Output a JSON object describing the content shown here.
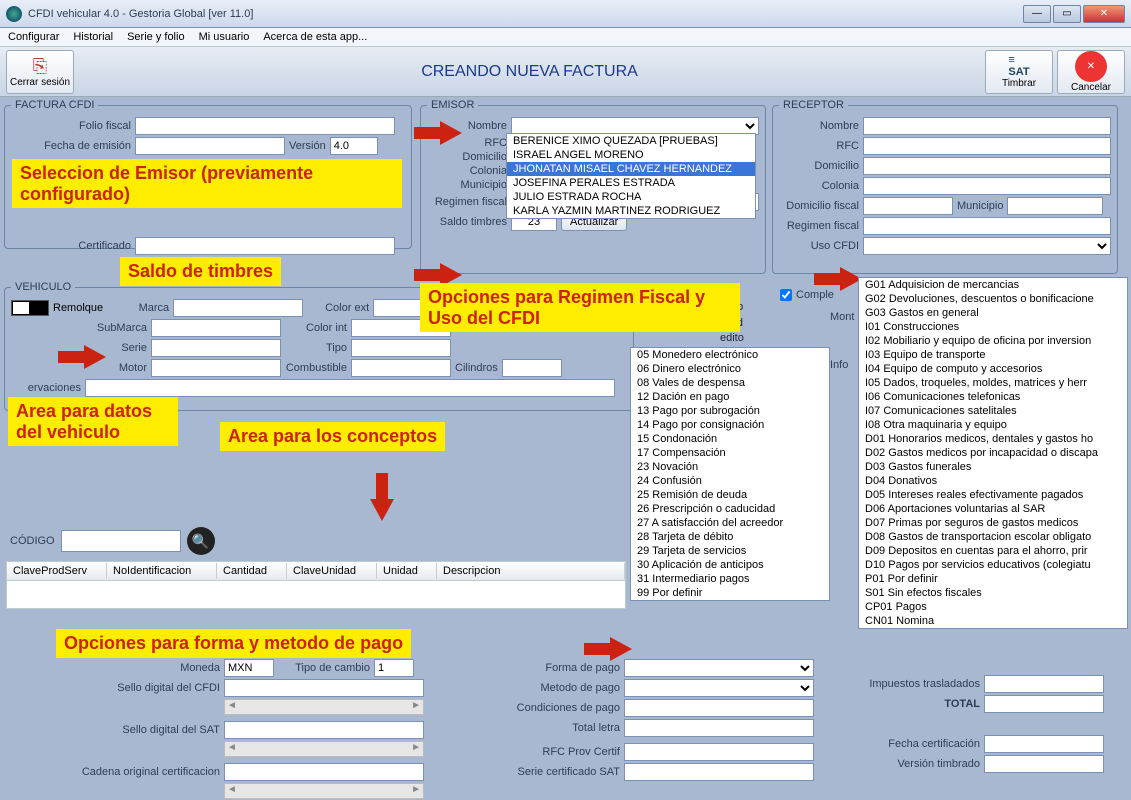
{
  "window": {
    "title": "CFDI vehicular 4.0 - Gestoria Global [ver 11.0]"
  },
  "menu": {
    "items": [
      "Configurar",
      "Historial",
      "Serie y folio",
      "Mi usuario",
      "Acerca de esta app..."
    ]
  },
  "toolbar": {
    "logout": "Cerrar sesión",
    "title": "CREANDO NUEVA FACTURA",
    "timbrar": "Timbrar",
    "cancelar": "Cancelar"
  },
  "factura": {
    "legend": "FACTURA CFDI",
    "folio_lbl": "Folio fiscal",
    "fecha_lbl": "Fecha de emisión",
    "version_lbl": "Versión",
    "version_val": "4.0",
    "cert_lbl": "Certificado"
  },
  "emisor": {
    "legend": "EMISOR",
    "nombre_lbl": "Nombre",
    "rfc_lbl": "RFC",
    "dom_lbl": "Domicilio",
    "col_lbl": "Colonia",
    "mun_lbl": "Municipio",
    "reg_lbl": "Regimen fiscal",
    "saldo_lbl": "Saldo timbres",
    "saldo_val": "23",
    "actualizar": "Actualizar",
    "options": [
      "BERENICE XIMO QUEZADA [PRUEBAS]",
      "ISRAEL ANGEL MORENO",
      "JHONATAN MISAEL CHAVEZ HERNANDEZ",
      "JOSEFINA PERALES ESTRADA",
      "JULIO ESTRADA ROCHA",
      "KARLA YAZMIN MARTINEZ RODRIGUEZ"
    ]
  },
  "receptor": {
    "legend": "RECEPTOR",
    "nombre_lbl": "Nombre",
    "rfc_lbl": "RFC",
    "dom_lbl": "Domicilio",
    "col_lbl": "Colonia",
    "domfis_lbl": "Domicilio fiscal",
    "mun_lbl": "Municipio",
    "reg_lbl": "Regimen fiscal",
    "uso_lbl": "Uso CFDI",
    "comple_lbl": "Comple",
    "mont_lbl": "Mont",
    "info_lbl": "Info"
  },
  "vehiculo": {
    "legend": "VEHICULO",
    "remolque": "Remolque",
    "marca": "Marca",
    "submarca": "SubMarca",
    "serie": "Serie",
    "motor": "Motor",
    "obs": "ervaciones",
    "colorext": "Color ext",
    "colorint": "Color int",
    "tipo": "Tipo",
    "combustible": "Combustible",
    "cilindros": "Cilindros"
  },
  "conceptos": {
    "codigo_lbl": "CÓDIGO",
    "headers": [
      "ClaveProdServ",
      "NoIdentificacion",
      "Cantidad",
      "ClaveUnidad",
      "Unidad",
      "Descripcion"
    ]
  },
  "pago": {
    "moneda_lbl": "Moneda",
    "moneda_val": "MXN",
    "tc_lbl": "Tipo de cambio",
    "tc_val": "1",
    "sello_cfdi": "Sello digital del CFDI",
    "sello_sat": "Sello digital del SAT",
    "cadena": "Cadena original certificacion",
    "forma_lbl": "Forma de pago",
    "metodo_lbl": "Metodo de pago",
    "cond_lbl": "Condiciones de pago",
    "total_letra": "Total letra",
    "rfc_prov": "RFC Prov Certif",
    "serie_sat": "Serie certificado SAT",
    "fecha_cert": "Fecha certificación",
    "version_timb": "Versión timbrado",
    "imp_lbl": "Impuestos trasladados",
    "total_lbl": "TOTAL"
  },
  "forma_pago_extra": {
    "ativo": "ativo",
    "efondos": "electrónica de fond",
    "edito": "edito"
  },
  "forma_pago_options": [
    "05 Monedero electrónico",
    "06 Dinero electrónico",
    "08 Vales de despensa",
    "12 Dación en pago",
    "13 Pago por subrogación",
    "14 Pago por consignación",
    "15 Condonación",
    "17 Compensación",
    "23 Novación",
    "24 Confusión",
    "25 Remisión de deuda",
    "26 Prescripción o caducidad",
    "27 A satisfacción del acreedor",
    "28 Tarjeta de débito",
    "29 Tarjeta de servicios",
    "30 Aplicación de anticipos",
    "31 Intermediario pagos",
    "99 Por definir"
  ],
  "uso_cfdi_options": [
    "G01 Adquisicion de mercancias",
    "G02 Devoluciones, descuentos o bonificacione",
    "G03 Gastos en general",
    "I01 Construcciones",
    "I02 Mobiliario y equipo de oficina por inversion",
    "I03 Equipo de transporte",
    "I04 Equipo de computo y accesorios",
    "I05 Dados, troqueles, moldes, matrices y herr",
    "I06 Comunicaciones telefonicas",
    "I07 Comunicaciones satelitales",
    "I08 Otra maquinaria y equipo",
    "D01 Honorarios medicos, dentales y gastos ho",
    "D02 Gastos medicos por incapacidad o discapa",
    "D03 Gastos funerales",
    "D04 Donativos",
    "D05 Intereses reales efectivamente pagados",
    "D06 Aportaciones voluntarias al SAR",
    "D07 Primas por seguros de gastos medicos",
    "D08 Gastos de transportacion escolar obligato",
    "D09 Depositos en cuentas para el ahorro, prir",
    "D10 Pagos por servicios educativos (colegiatu",
    "P01 Por definir",
    "S01 Sin efectos fiscales",
    "CP01 Pagos",
    "CN01 Nomina"
  ],
  "annot": {
    "emisor": "Seleccion de Emisor (previamente configurado)",
    "saldo": "Saldo de timbres",
    "regimen": "Opciones para Regimen Fiscal y Uso del CFDI",
    "vehiculo": "Area para datos del vehiculo",
    "conceptos": "Area para los conceptos",
    "pago": "Opciones para forma y metodo de pago"
  }
}
